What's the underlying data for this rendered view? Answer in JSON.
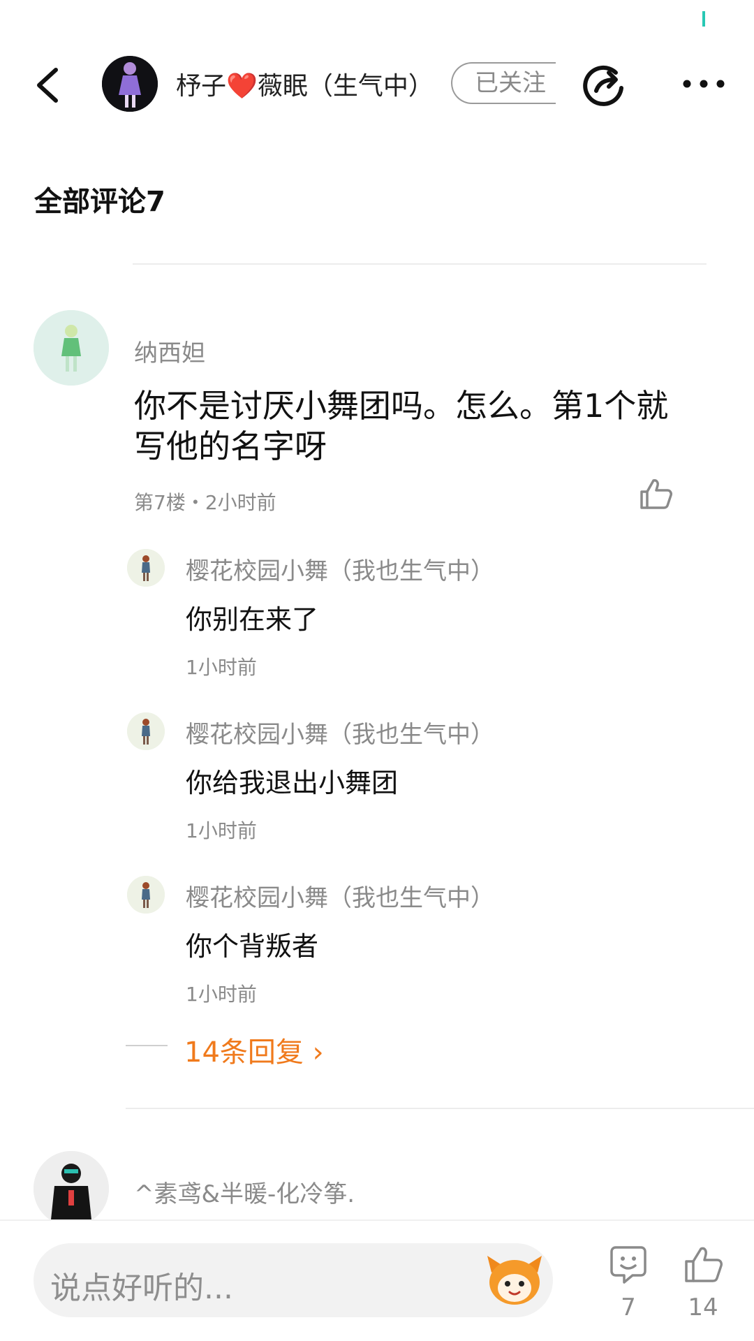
{
  "header": {
    "author_name": "杼子❤️薇眠（生气中）",
    "follow_label": "已关注",
    "icons": {
      "back": "chevron-left-icon",
      "share": "share-icon",
      "more": "more-dots-icon"
    }
  },
  "section": {
    "title": "全部评论7"
  },
  "comment": {
    "user": "纳西妲",
    "text": "你不是讨厌小舞团吗。怎么。第1个就写他的名字呀",
    "meta": "第7楼・2小时前",
    "replies": [
      {
        "user": "樱花校园小舞（我也生气中）",
        "text": "你别在来了",
        "time": "1小时前"
      },
      {
        "user": "樱花校园小舞（我也生气中）",
        "text": "你给我退出小舞团",
        "time": "1小时前"
      },
      {
        "user": "樱花校园小舞（我也生气中）",
        "text": "你个背叛者",
        "time": "1小时前"
      }
    ],
    "more_replies_label": "14条回复 ›"
  },
  "comment2": {
    "user": "^素鸢&半暖-化冷筝."
  },
  "bottom_bar": {
    "input_placeholder": "说点好听的...",
    "comment_count": "7",
    "like_count": "14"
  },
  "colors": {
    "accent": "#f07a1c",
    "status_mark": "#28c8b4",
    "muted_text": "#8a8a8a"
  }
}
